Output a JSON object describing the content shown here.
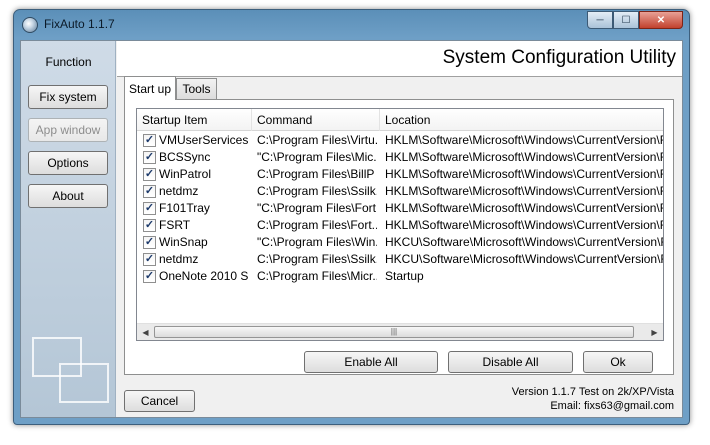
{
  "window": {
    "title": "FixAuto 1.1.7"
  },
  "window_controls": {
    "minimize": "─",
    "maximize": "☐",
    "close": "✕"
  },
  "sidebar": {
    "title": "Function",
    "buttons": [
      {
        "label": "Fix system",
        "enabled": true
      },
      {
        "label": "App window",
        "enabled": false
      },
      {
        "label": "Options",
        "enabled": true
      },
      {
        "label": "About",
        "enabled": true
      }
    ]
  },
  "header": {
    "title": "System Configuration Utility"
  },
  "tabs": [
    {
      "label": "Start up",
      "active": true
    },
    {
      "label": "Tools",
      "active": false
    }
  ],
  "table": {
    "columns": [
      "Startup Item",
      "Command",
      "Location"
    ],
    "rows": [
      {
        "checked": true,
        "item": "VMUserServices",
        "command": "C:\\Program Files\\Virtu...",
        "location": "HKLM\\Software\\Microsoft\\Windows\\CurrentVersion\\Run"
      },
      {
        "checked": true,
        "item": "BCSSync",
        "command": "\"C:\\Program Files\\Mic...",
        "location": "HKLM\\Software\\Microsoft\\Windows\\CurrentVersion\\Run"
      },
      {
        "checked": true,
        "item": "WinPatrol",
        "command": "C:\\Program Files\\BillP ...",
        "location": "HKLM\\Software\\Microsoft\\Windows\\CurrentVersion\\Run"
      },
      {
        "checked": true,
        "item": "netdmz",
        "command": "C:\\Program Files\\Ssilk...",
        "location": "HKLM\\Software\\Microsoft\\Windows\\CurrentVersion\\Run"
      },
      {
        "checked": true,
        "item": "F101Tray",
        "command": "\"C:\\Program Files\\Fort...",
        "location": "HKLM\\Software\\Microsoft\\Windows\\CurrentVersion\\Run"
      },
      {
        "checked": true,
        "item": "FSRT",
        "command": "C:\\Program Files\\Fort...",
        "location": "HKLM\\Software\\Microsoft\\Windows\\CurrentVersion\\Run"
      },
      {
        "checked": true,
        "item": "WinSnap",
        "command": "\"C:\\Program Files\\Win...",
        "location": "HKCU\\Software\\Microsoft\\Windows\\CurrentVersion\\Run"
      },
      {
        "checked": true,
        "item": "netdmz",
        "command": "C:\\Program Files\\Ssilk...",
        "location": "HKCU\\Software\\Microsoft\\Windows\\CurrentVersion\\Run"
      },
      {
        "checked": true,
        "item": "OneNote 2010 S...",
        "command": "C:\\Program Files\\Micr...",
        "location": "Startup"
      }
    ],
    "check_mark": "✓",
    "scroll_left": "◀",
    "scroll_right": "▶",
    "scroll_grip": "|||"
  },
  "actions": {
    "enable_all": "Enable All",
    "disable_all": "Disable All",
    "ok": "Ok",
    "cancel": "Cancel"
  },
  "footer": {
    "version": "Version 1.1.7 Test on 2k/XP/Vista",
    "email": "Email: fixs63@gmail.com"
  }
}
